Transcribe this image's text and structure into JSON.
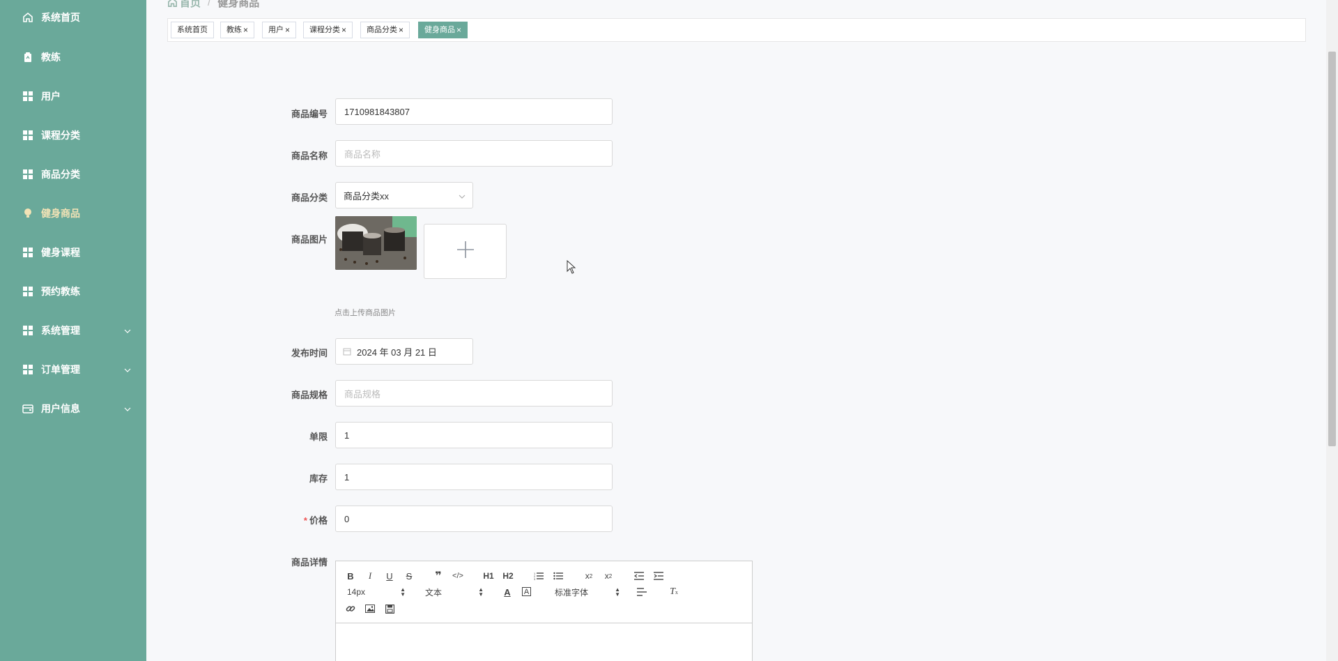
{
  "sidebar": {
    "items": [
      {
        "label": "系统首页",
        "icon": "home-icon"
      },
      {
        "label": "教练",
        "icon": "clipboard-icon"
      },
      {
        "label": "用户",
        "icon": "grid-icon"
      },
      {
        "label": "课程分类",
        "icon": "grid-icon"
      },
      {
        "label": "商品分类",
        "icon": "grid-icon"
      },
      {
        "label": "健身商品",
        "icon": "lightbulb-icon"
      },
      {
        "label": "健身课程",
        "icon": "grid-icon"
      },
      {
        "label": "预约教练",
        "icon": "grid-icon"
      },
      {
        "label": "系统管理",
        "icon": "grid-icon"
      },
      {
        "label": "订单管理",
        "icon": "grid-icon"
      },
      {
        "label": "用户信息",
        "icon": "wallet-icon"
      }
    ]
  },
  "breadcrumb": {
    "home": "首页",
    "sep": "/",
    "current": "健身商品"
  },
  "tags": [
    {
      "label": "系统首页",
      "closable": false
    },
    {
      "label": "教练",
      "closable": true
    },
    {
      "label": "用户",
      "closable": true
    },
    {
      "label": "课程分类",
      "closable": true
    },
    {
      "label": "商品分类",
      "closable": true
    },
    {
      "label": "健身商品",
      "closable": true
    }
  ],
  "tag_close": "×",
  "form": {
    "code_label": "商品编号",
    "code_value": "1710981843807",
    "name_label": "商品名称",
    "name_placeholder": "商品名称",
    "category_label": "商品分类",
    "category_value": "商品分类xx",
    "image_label": "商品图片",
    "upload_hint": "点击上传商品图片",
    "date_label": "发布时间",
    "date_value": "2024 年 03 月 21 日",
    "spec_label": "商品规格",
    "spec_placeholder": "商品规格",
    "limit_label": "单限",
    "limit_value": "1",
    "stock_label": "库存",
    "stock_value": "1",
    "price_required": "*",
    "price_label": "价格",
    "price_value": "0",
    "detail_label": "商品详情"
  },
  "editor": {
    "font_size": "14px",
    "block_type": "文本",
    "font_family": "标准字体"
  },
  "colors": {
    "sidebar": "#6aa99a",
    "active_nav": "#f3e3b6",
    "active_tag": "#6aa99a"
  }
}
